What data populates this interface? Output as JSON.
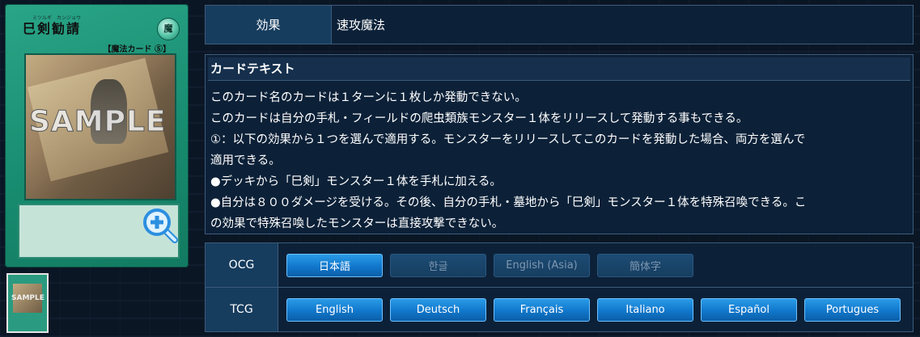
{
  "card": {
    "name": "巳剣勧請",
    "ruby": "ミツルギ　カンジョウ",
    "attribute_glyph": "魔",
    "type_line": "【魔法カード ⑤】",
    "watermark": "SAMPLE",
    "thumb_watermark": "SAMPLE",
    "zoom_icon": "zoom-in-icon"
  },
  "effect": {
    "label": "効果",
    "value": "速攻魔法"
  },
  "card_text": {
    "title": "カードテキスト",
    "body": "このカード名のカードは１ターンに１枚しか発動できない。\nこのカードは自分の手札・フィールドの爬虫類族モンスター１体をリリースして発動する事もできる。\n①：以下の効果から１つを選んで適用する。モンスターをリリースしてこのカードを発動した場合、両方を選んで\n適用できる。\n●デッキから「巳剣」モンスター１体を手札に加える。\n●自分は８００ダメージを受ける。その後、自分の手札・墓地から「巳剣」モンスター１体を特殊召喚できる。こ\nの効果で特殊召喚したモンスターは直接攻撃できない。"
  },
  "languages": {
    "ocg_label": "OCG",
    "tcg_label": "TCG",
    "ocg": [
      {
        "label": "日本語",
        "active": true
      },
      {
        "label": "한글",
        "active": false
      },
      {
        "label": "English (Asia)",
        "active": false
      },
      {
        "label": "簡体字",
        "active": false
      }
    ],
    "tcg": [
      {
        "label": "English",
        "active": true
      },
      {
        "label": "Deutsch",
        "active": true
      },
      {
        "label": "Français",
        "active": true
      },
      {
        "label": "Italiano",
        "active": true
      },
      {
        "label": "Español",
        "active": true
      },
      {
        "label": "Portugues",
        "active": true
      }
    ]
  }
}
